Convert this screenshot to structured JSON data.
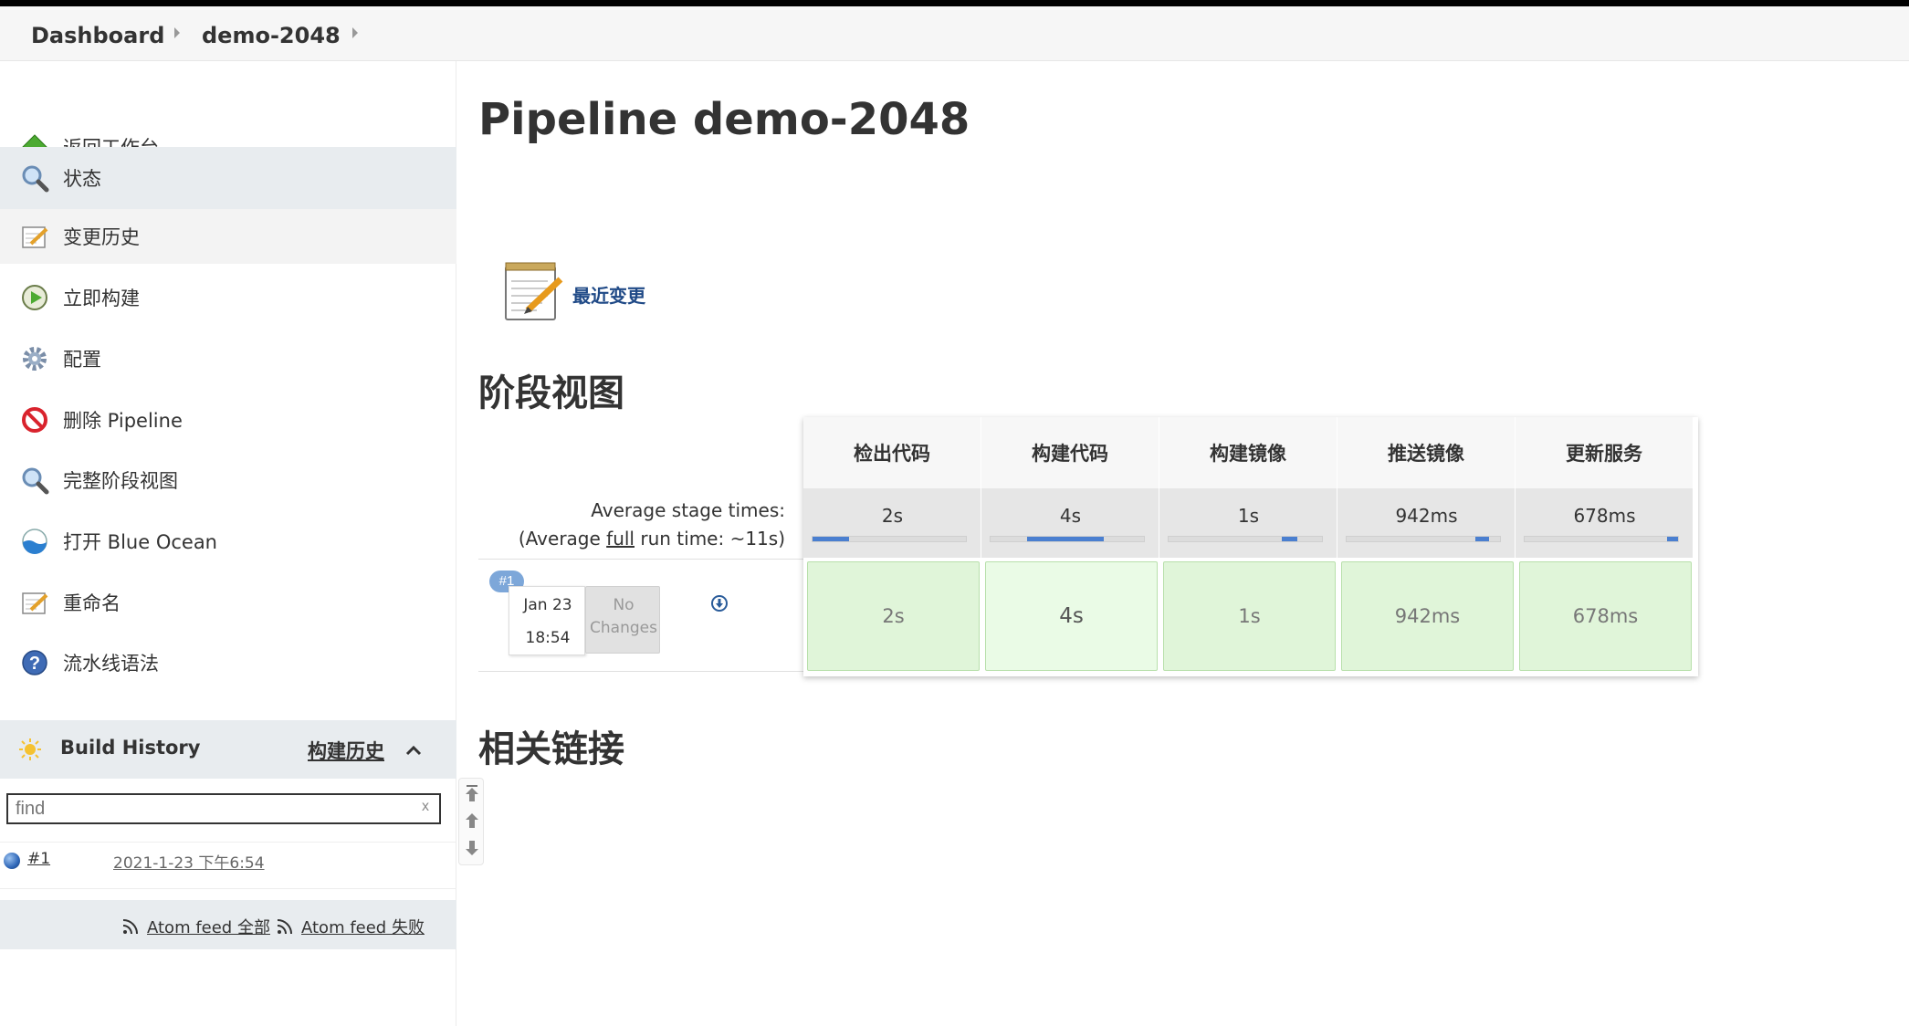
{
  "breadcrumb": {
    "items": [
      "Dashboard",
      "demo-2048"
    ]
  },
  "sidebar": {
    "items": [
      {
        "label": "返回工作台",
        "icon": "up-arrow-icon"
      },
      {
        "label": "状态",
        "icon": "magnifier-icon"
      },
      {
        "label": "变更历史",
        "icon": "notepad-icon"
      },
      {
        "label": "立即构建",
        "icon": "build-clock-icon"
      },
      {
        "label": "配置",
        "icon": "gear-icon"
      },
      {
        "label": "删除 Pipeline",
        "icon": "no-entry-icon"
      },
      {
        "label": "完整阶段视图",
        "icon": "magnifier-icon"
      },
      {
        "label": "打开 Blue Ocean",
        "icon": "blue-ocean-icon"
      },
      {
        "label": "重命名",
        "icon": "notepad-icon"
      },
      {
        "label": "流水线语法",
        "icon": "help-icon"
      }
    ]
  },
  "build_history": {
    "title": "Build History",
    "link_label": "构建历史",
    "search_placeholder": "find",
    "search_clear": "x",
    "builds": [
      {
        "number": "#1",
        "date": "2021-1-23 下午6:54"
      }
    ],
    "feeds": [
      "Atom feed 全部",
      "Atom feed 失败"
    ]
  },
  "main": {
    "title": "Pipeline demo-2048",
    "recent_changes_label": "最近变更",
    "stage_view_title": "阶段视图",
    "related_links_title": "相关链接"
  },
  "stage_view": {
    "avg_label": "Average stage times:",
    "avg_full_prefix": "(Average ",
    "avg_full_link": "full",
    "avg_full_suffix": " run time: ~11s)",
    "stages": [
      {
        "name": "检出代码",
        "avg": "2s",
        "bar_start": 0.0,
        "bar_fraction": 0.24
      },
      {
        "name": "构建代码",
        "avg": "4s",
        "bar_start": 0.24,
        "bar_fraction": 0.5
      },
      {
        "name": "构建镜像",
        "avg": "1s",
        "bar_start": 0.74,
        "bar_fraction": 0.1
      },
      {
        "name": "推送镜像",
        "avg": "942ms",
        "bar_start": 0.84,
        "bar_fraction": 0.09
      },
      {
        "name": "更新服务",
        "avg": "678ms",
        "bar_start": 0.93,
        "bar_fraction": 0.07
      }
    ],
    "run": {
      "badge": "#1",
      "date": "Jan 23",
      "time": "18:54",
      "no_changes": [
        "No",
        "Changes"
      ],
      "durations": [
        "2s",
        "4s",
        "1s",
        "942ms",
        "678ms"
      ]
    }
  }
}
